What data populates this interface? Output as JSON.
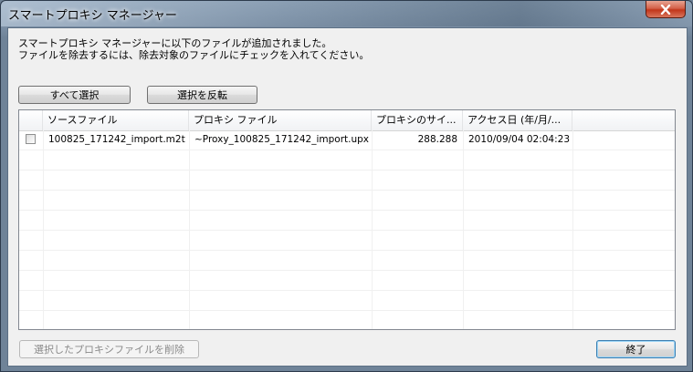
{
  "window": {
    "title": "スマートプロキシ マネージャー"
  },
  "message": {
    "line1": "スマートプロキシ マネージャーに以下のファイルが追加されました。",
    "line2": "ファイルを除去するには、除去対象のファイルにチェックを入れてください。"
  },
  "buttons": {
    "select_all": "すべて選択",
    "invert_selection": "選択を反転",
    "delete_selected": "選択したプロキシファイルを削除",
    "finish": "終了"
  },
  "table": {
    "columns": [
      "ソースファイル",
      "プロキシ ファイル",
      "プロキシのサイ...",
      "アクセス日 (年/月/..."
    ],
    "rows": [
      {
        "checked": false,
        "source": "100825_171242_import.m2t",
        "proxy": "~Proxy_100825_171242_import.upx",
        "size": "288.288",
        "access": "2010/09/04 02:04:23"
      }
    ]
  },
  "icons": {
    "close": "close-icon"
  },
  "colors": {
    "close_button": "#c8462b",
    "default_button_border": "#3c7fb1",
    "disabled_text": "#8a8a8a"
  }
}
